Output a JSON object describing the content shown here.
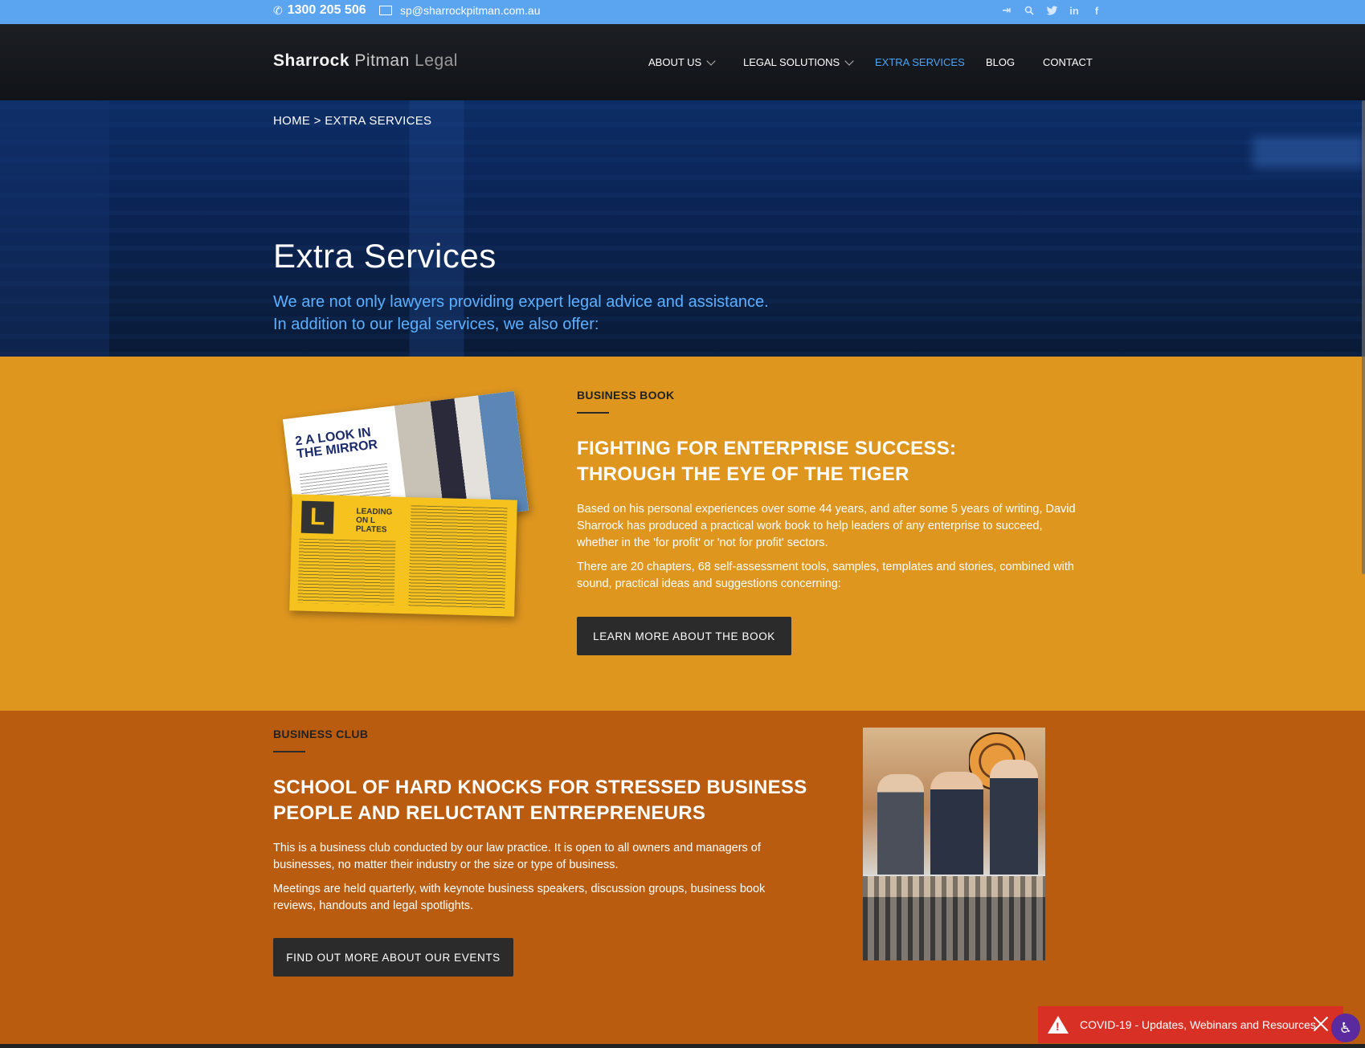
{
  "topbar": {
    "phone_icon": "phone-icon",
    "phone": "1300 205 506",
    "email_icon": "envelope-icon",
    "email": "sp@sharrockpitman.com.au",
    "social": [
      {
        "name": "login-icon",
        "glyph": "⇥"
      },
      {
        "name": "search-icon",
        "glyph": "⌕"
      },
      {
        "name": "twitter-icon",
        "glyph": "🐦"
      },
      {
        "name": "linkedin-icon",
        "glyph": "in"
      },
      {
        "name": "facebook-icon",
        "glyph": "f"
      }
    ]
  },
  "header": {
    "logo": {
      "part1": "Sharrock",
      "part2": "Pitman",
      "part3": "Legal"
    },
    "nav": [
      {
        "label": "ABOUT US",
        "dropdown": true
      },
      {
        "label": "LEGAL SOLUTIONS",
        "dropdown": true
      },
      {
        "label": "EXTRA SERVICES",
        "active": true
      },
      {
        "label": "BLOG"
      },
      {
        "label": "CONTACT"
      }
    ]
  },
  "hero": {
    "breadcrumb": "HOME > EXTRA SERVICES",
    "title": "Extra Services",
    "intro_line1": "We are not only lawyers providing expert legal advice and assistance.",
    "intro_line2": "In addition to our legal services, we also offer:"
  },
  "book": {
    "label": "BUSINESS BOOK",
    "title_line1": "FIGHTING FOR ENTERPRISE SUCCESS:",
    "title_line2": "THROUGH THE EYE OF THE TIGER",
    "para1": "Based on his personal experiences over some 44 years, and after some 5 years of writing, David Sharrock has produced a practical work book to help leaders of any enterprise to succeed, whether in the 'for profit' or 'not for profit' sectors.",
    "para2": "There are 20 chapters, 68 self-assessment tools, samples, templates and stories, combined with sound, practical ideas and suggestions concerning:",
    "button": "LEARN MORE ABOUT THE BOOK",
    "image_page1_title": "2 A LOOK IN THE MIRROR",
    "image_page2_title": "LEADING ON L PLATES"
  },
  "club": {
    "label": "BUSINESS CLUB",
    "title_line1": "SCHOOL OF HARD KNOCKS FOR STRESSED BUSINESS",
    "title_line2": "PEOPLE AND RELUCTANT ENTREPRENEURS",
    "para1": "This is a business club conducted by our law practice. It is open to all owners and managers of businesses, no matter their industry or the size or type of business.",
    "para2": "Meetings are held quarterly, with keynote business speakers, discussion groups, business book reviews, handouts and legal spotlights.",
    "button": "FIND OUT MORE ABOUT OUR EVENTS"
  },
  "covid": {
    "text": "COVID-19 - Updates, Webinars and Resources"
  },
  "colors": {
    "topbar": "#5ba4f0",
    "nav_active": "#4aa3f5",
    "book_bg": "#de961f",
    "club_bg": "#b95c0f",
    "covid_bg": "#d93025"
  }
}
